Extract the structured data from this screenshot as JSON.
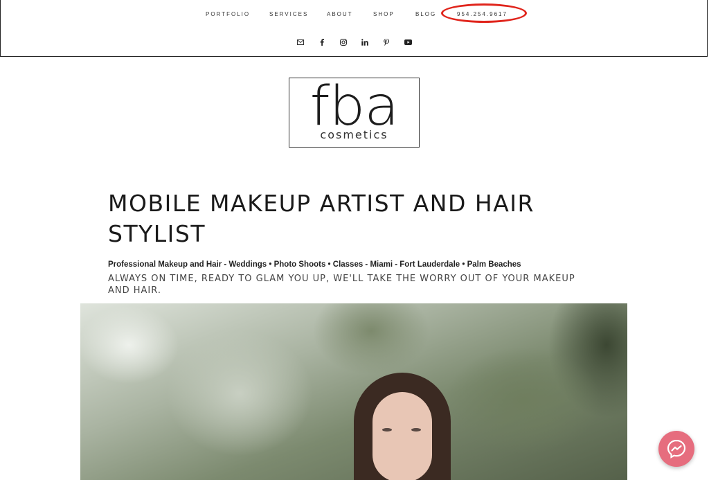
{
  "nav": {
    "items": [
      "PORTFOLIO",
      "SERVICES",
      "ABOUT",
      "SHOP",
      "BLOG"
    ],
    "phone": "954.254.9617"
  },
  "social": {
    "icons": [
      "email-icon",
      "facebook-icon",
      "instagram-icon",
      "linkedin-icon",
      "pinterest-icon",
      "youtube-icon"
    ]
  },
  "logo": {
    "main": "fba",
    "sub": "cosmetics"
  },
  "hero": {
    "title": "MOBILE MAKEUP ARTIST AND HAIR STYLIST",
    "tagline": "Professional Makeup and Hair - Weddings • Photo Shoots • Classes - Miami - Fort Lauderdale • Palm Beaches",
    "subtitle": "ALWAYS ON TIME, READY TO GLAM YOU UP, WE'LL TAKE THE WORRY OUT OF YOUR MAKEUP AND HAIR."
  },
  "colors": {
    "highlight_ring": "#e0241b",
    "messenger": "#e66d7e"
  }
}
